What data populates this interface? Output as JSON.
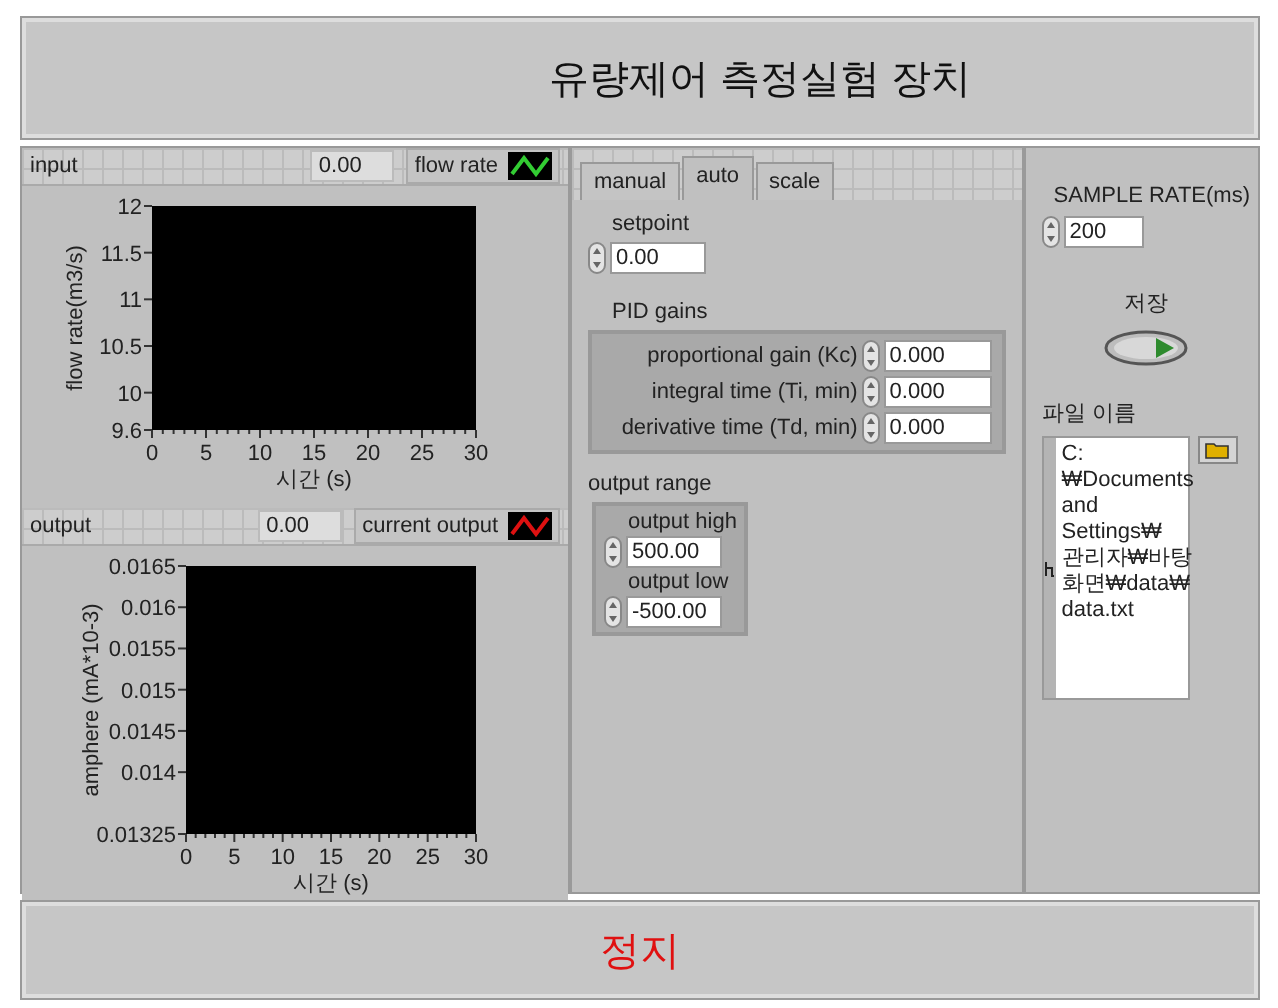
{
  "window": {
    "title": "유량제어 측정실험 장치"
  },
  "graphs": [
    {
      "label": "input",
      "value": "0.00",
      "legend": {
        "label": "flow rate",
        "color": "#33cc33"
      },
      "chart_data": {
        "type": "line",
        "xlabel": "시간 (s)",
        "ylabel": "flow rate(m3/s)",
        "xlim": [
          0,
          30
        ],
        "ylim": [
          9.6,
          12
        ],
        "xticks": [
          0,
          5,
          10,
          15,
          20,
          25,
          30
        ],
        "yticks": [
          9.6,
          10,
          10.5,
          11,
          11.5,
          12
        ]
      }
    },
    {
      "label": "output",
      "value": "0.00",
      "legend": {
        "label": "current output",
        "color": "#dd1111"
      },
      "chart_data": {
        "type": "line",
        "xlabel": "시간 (s)",
        "ylabel": "amphere (mA*10-3)",
        "xlim": [
          0,
          30
        ],
        "ylim": [
          0.01325,
          0.0165
        ],
        "xticks": [
          0,
          5,
          10,
          15,
          20,
          25,
          30
        ],
        "yticks": [
          0.01325,
          0.014,
          0.0145,
          0.015,
          0.0155,
          0.016,
          0.0165
        ]
      }
    }
  ],
  "tabs": [
    {
      "label": "manual",
      "selected": false
    },
    {
      "label": "auto",
      "selected": true
    },
    {
      "label": "scale",
      "selected": false
    }
  ],
  "setpoint": {
    "label": "setpoint",
    "value": "0.00"
  },
  "pid_gains": {
    "label": "PID gains",
    "fields": [
      {
        "label": "proportional gain (Kc)",
        "value": "0.000"
      },
      {
        "label": "integral time (Ti, min)",
        "value": "0.000"
      },
      {
        "label": "derivative time (Td, min)",
        "value": "0.000"
      }
    ]
  },
  "output_range": {
    "label": "output range",
    "fields": [
      {
        "label": "output high",
        "value": "500.00"
      },
      {
        "label": "output low",
        "value": "-500.00"
      }
    ]
  },
  "sample_rate": {
    "label": "SAMPLE RATE(ms)",
    "value": "200"
  },
  "save_button": {
    "label": "저장"
  },
  "file_path": {
    "label": "파일 이름",
    "lines": [
      "C:",
      "₩Documents",
      "and",
      "Settings₩",
      "관리자₩바탕",
      "화면₩data₩",
      "data.txt"
    ]
  },
  "stop_button": {
    "label": "정지"
  }
}
